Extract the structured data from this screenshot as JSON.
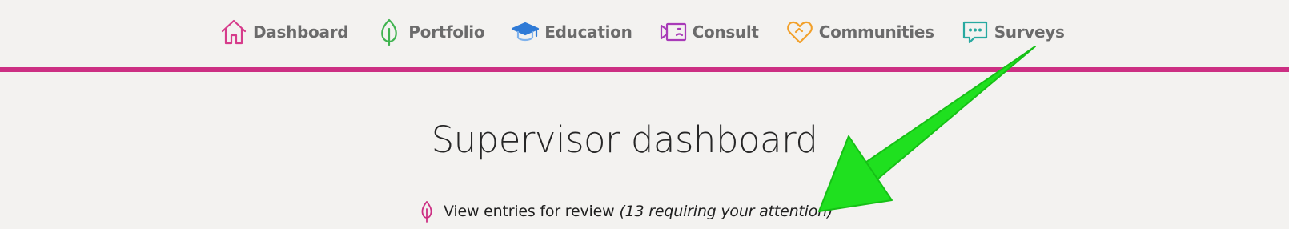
{
  "nav": {
    "items": [
      {
        "label": "Dashboard",
        "icon": "home-icon",
        "color": "#d63c8b"
      },
      {
        "label": "Portfolio",
        "icon": "leaf-icon",
        "color": "#3fb34f"
      },
      {
        "label": "Education",
        "icon": "graduation-cap-icon",
        "color": "#2f7ad6"
      },
      {
        "label": "Consult",
        "icon": "video-camera-icon",
        "color": "#a83bb8"
      },
      {
        "label": "Communities",
        "icon": "heart-icon",
        "color": "#f2a02a"
      },
      {
        "label": "Surveys",
        "icon": "chat-bubble-icon",
        "color": "#27a9a0"
      }
    ],
    "accent_color": "#cc2f83"
  },
  "main": {
    "title": "Supervisor dashboard",
    "review_link": {
      "icon": "leaf-icon",
      "label": "View entries for review",
      "note": "(13 requiring your attention)"
    }
  },
  "annotation": {
    "icon": "arrow-icon",
    "color": "#1fe01f"
  }
}
